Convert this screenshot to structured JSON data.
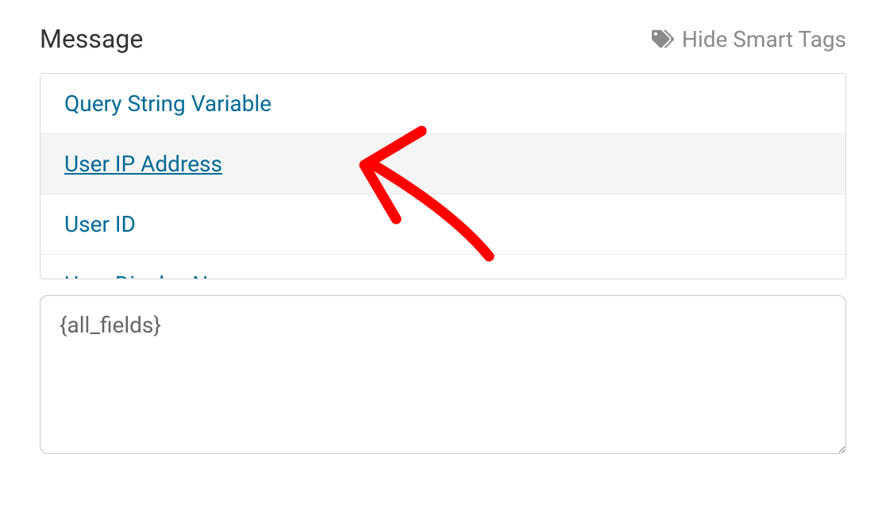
{
  "header": {
    "title": "Message",
    "hide_label": "Hide Smart Tags"
  },
  "tags": {
    "items": [
      {
        "label": "Query String Variable",
        "hovered": false
      },
      {
        "label": "User IP Address",
        "hovered": true
      },
      {
        "label": "User ID",
        "hovered": false
      },
      {
        "label": "User Display Name",
        "hovered": false
      }
    ]
  },
  "message": {
    "value": "{all_fields}"
  }
}
